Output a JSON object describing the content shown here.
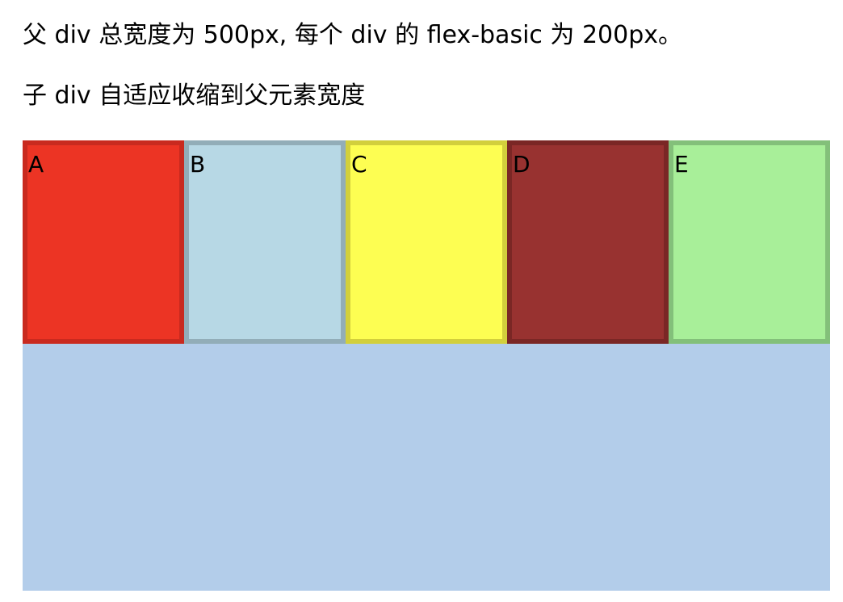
{
  "text": {
    "line1": "父 div 总宽度为 500px, 每个 div 的 flex-basic 为 200px。",
    "line2": "子 div 自适应收缩到父元素宽度"
  },
  "parent": {
    "background": "#b3cdea"
  },
  "children": [
    {
      "label": "A",
      "fill": "#ec3424",
      "border": "#c92a1f"
    },
    {
      "label": "B",
      "fill": "#b7d8e5",
      "border": "#92adb8"
    },
    {
      "label": "C",
      "fill": "#fdfe52",
      "border": "#d2cf3c"
    },
    {
      "label": "D",
      "fill": "#983230",
      "border": "#7a2725"
    },
    {
      "label": "E",
      "fill": "#a8ef99",
      "border": "#83c07a"
    }
  ]
}
